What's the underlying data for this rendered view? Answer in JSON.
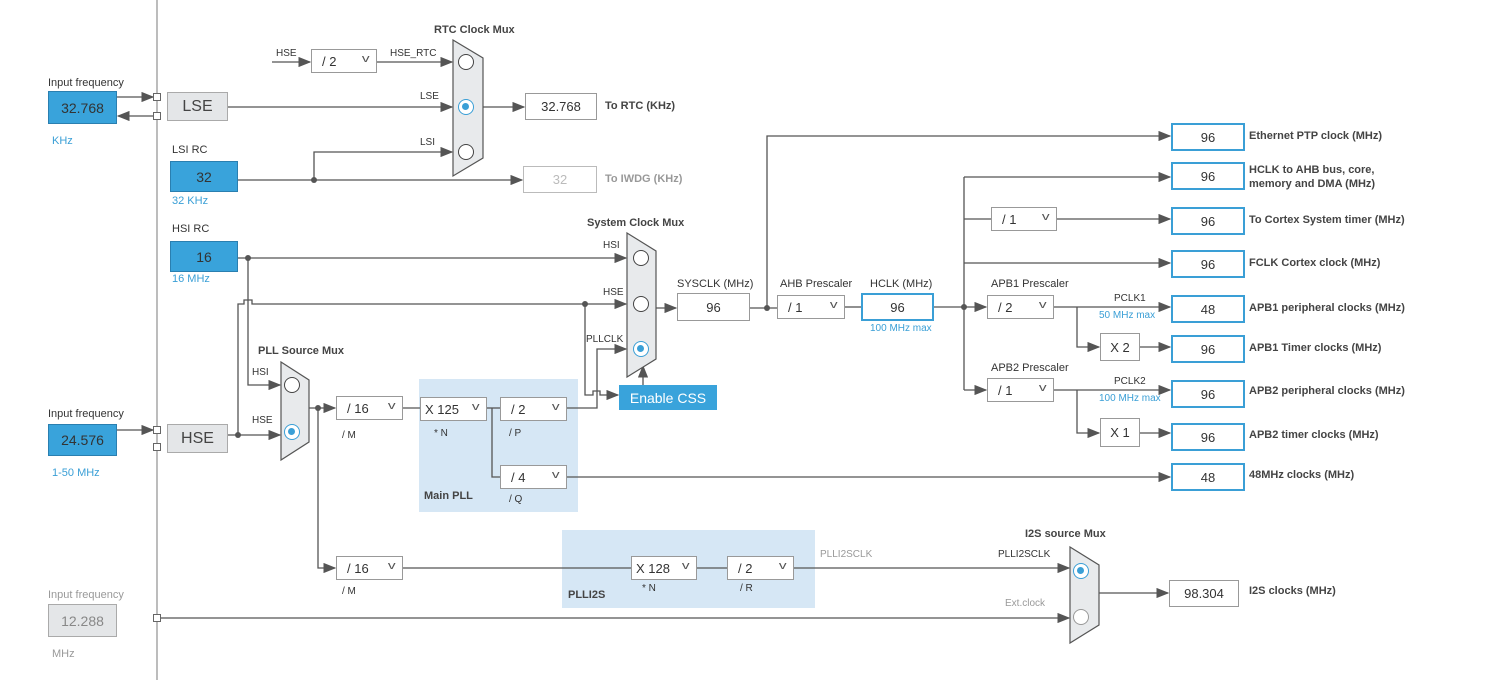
{
  "lse_input": {
    "label": "Input frequency",
    "value": "32.768",
    "unit": "KHz"
  },
  "lse": {
    "label": "LSE"
  },
  "lsi_rc": {
    "label": "LSI RC",
    "value": "32",
    "unit": "32 KHz"
  },
  "hsi_rc": {
    "label": "HSI RC",
    "value": "16",
    "unit": "16 MHz"
  },
  "hse_input": {
    "label": "Input frequency",
    "value": "24.576",
    "unit": "1-50 MHz"
  },
  "hse": {
    "label": "HSE"
  },
  "ext_input": {
    "label": "Input frequency",
    "value": "12.288",
    "unit": "MHz"
  },
  "rtc_mux": {
    "title": "RTC Clock Mux",
    "hse_label": "HSE",
    "hse_div": "/ 2",
    "hse_rtc": "HSE_RTC",
    "lse": "LSE",
    "lsi": "LSI",
    "selected": "LSE"
  },
  "to_rtc": {
    "value": "32.768",
    "label": "To RTC (KHz)"
  },
  "to_iwdg": {
    "value": "32",
    "label": "To IWDG (KHz)"
  },
  "sys_mux": {
    "title": "System Clock Mux",
    "hsi": "HSI",
    "hse": "HSE",
    "pllclk": "PLLCLK",
    "selected": "PLLCLK"
  },
  "enable_css": "Enable CSS",
  "sysclk": {
    "label": "SYSCLK (MHz)",
    "value": "96"
  },
  "ahb": {
    "label": "AHB Prescaler",
    "value": "/ 1"
  },
  "hclk": {
    "label": "HCLK (MHz)",
    "value": "96",
    "max": "100 MHz max"
  },
  "apb1": {
    "label": "APB1 Prescaler",
    "value": "/ 2",
    "pclk": "PCLK1",
    "max": "50 MHz max",
    "timer_mult": "X 2"
  },
  "apb2": {
    "label": "APB2 Prescaler",
    "value": "/ 1",
    "pclk": "PCLK2",
    "max": "100 MHz max",
    "timer_mult": "X 1"
  },
  "cortex_div": "/ 1",
  "pll_mux": {
    "title": "PLL Source Mux",
    "hsi": "HSI",
    "hse": "HSE",
    "selected": "HSE"
  },
  "main_pll": {
    "title": "Main PLL",
    "m": "/ 16",
    "m_label": "/ M",
    "n": "X 125",
    "n_label": "* N",
    "p": "/ 2",
    "p_label": "/ P",
    "q": "/ 4",
    "q_label": "/ Q"
  },
  "plli2s": {
    "title": "PLLI2S",
    "m": "/ 16",
    "m_label": "/ M",
    "n": "X 128",
    "n_label": "* N",
    "r": "/ 2",
    "r_label": "/ R",
    "out_label": "PLLI2SCLK"
  },
  "i2s_mux": {
    "title": "I2S source Mux",
    "plli2sclk": "PLLI2SCLK",
    "ext": "Ext.clock",
    "selected": "PLLI2SCLK"
  },
  "i2s_out": {
    "value": "98.304",
    "label": "I2S clocks (MHz)"
  },
  "outputs": [
    {
      "value": "96",
      "label": "Ethernet PTP clock (MHz)"
    },
    {
      "value": "96",
      "label": "HCLK to AHB bus, core, memory and DMA (MHz)"
    },
    {
      "value": "96",
      "label": "To Cortex System timer (MHz)"
    },
    {
      "value": "96",
      "label": "FCLK Cortex clock (MHz)"
    },
    {
      "value": "48",
      "label": "APB1 peripheral clocks (MHz)"
    },
    {
      "value": "96",
      "label": "APB1 Timer clocks (MHz)"
    },
    {
      "value": "96",
      "label": "APB2 peripheral clocks (MHz)"
    },
    {
      "value": "96",
      "label": "APB2 timer clocks (MHz)"
    },
    {
      "value": "48",
      "label": "48MHz clocks (MHz)"
    }
  ],
  "colors": {
    "accent": "#39a3db",
    "pll_bg": "#d6e7f5",
    "wire": "#555555"
  }
}
